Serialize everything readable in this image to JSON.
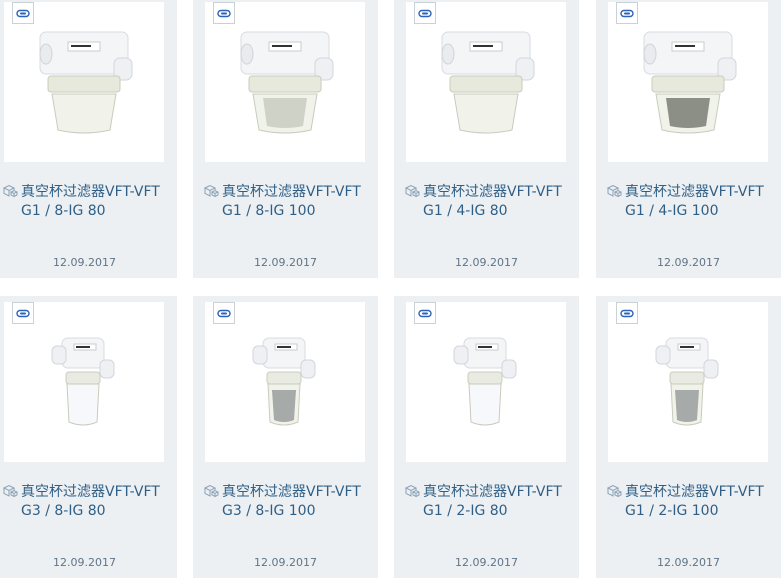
{
  "colors": {
    "card_bg": "#edf0f3",
    "title_text": "#2f5f86",
    "date_text": "#5f7487",
    "badge_accent": "#2b63b8"
  },
  "icons": {
    "badge": "3d-model-icon",
    "title": "cube-icon"
  },
  "products": [
    {
      "title_line1": "真空杯过滤器VFT-VFT",
      "title_line2": "G1 / 8-IG 80",
      "date": "12.09.2017",
      "variant": "wide-clear"
    },
    {
      "title_line1": "真空杯过滤器VFT-VFT",
      "title_line2": "G1 / 8-IG 100",
      "date": "12.09.2017",
      "variant": "wide-screen"
    },
    {
      "title_line1": "真空杯过滤器VFT-VFT",
      "title_line2": "G1 / 4-IG 80",
      "date": "12.09.2017",
      "variant": "wide-clear"
    },
    {
      "title_line1": "真空杯过滤器VFT-VFT",
      "title_line2": "G1 / 4-IG 100",
      "date": "12.09.2017",
      "variant": "wide-dark"
    },
    {
      "title_line1": "真空杯过滤器VFT-VFT",
      "title_line2": "G3 / 8-IG 80",
      "date": "12.09.2017",
      "variant": "tall-white"
    },
    {
      "title_line1": "真空杯过滤器VFT-VFT",
      "title_line2": "G3 / 8-IG 100",
      "date": "12.09.2017",
      "variant": "tall-grey"
    },
    {
      "title_line1": "真空杯过滤器VFT-VFT",
      "title_line2": "G1 / 2-IG 80",
      "date": "12.09.2017",
      "variant": "tall-white"
    },
    {
      "title_line1": "真空杯过滤器VFT-VFT",
      "title_line2": "G1 / 2-IG 100",
      "date": "12.09.2017",
      "variant": "tall-grey"
    }
  ]
}
